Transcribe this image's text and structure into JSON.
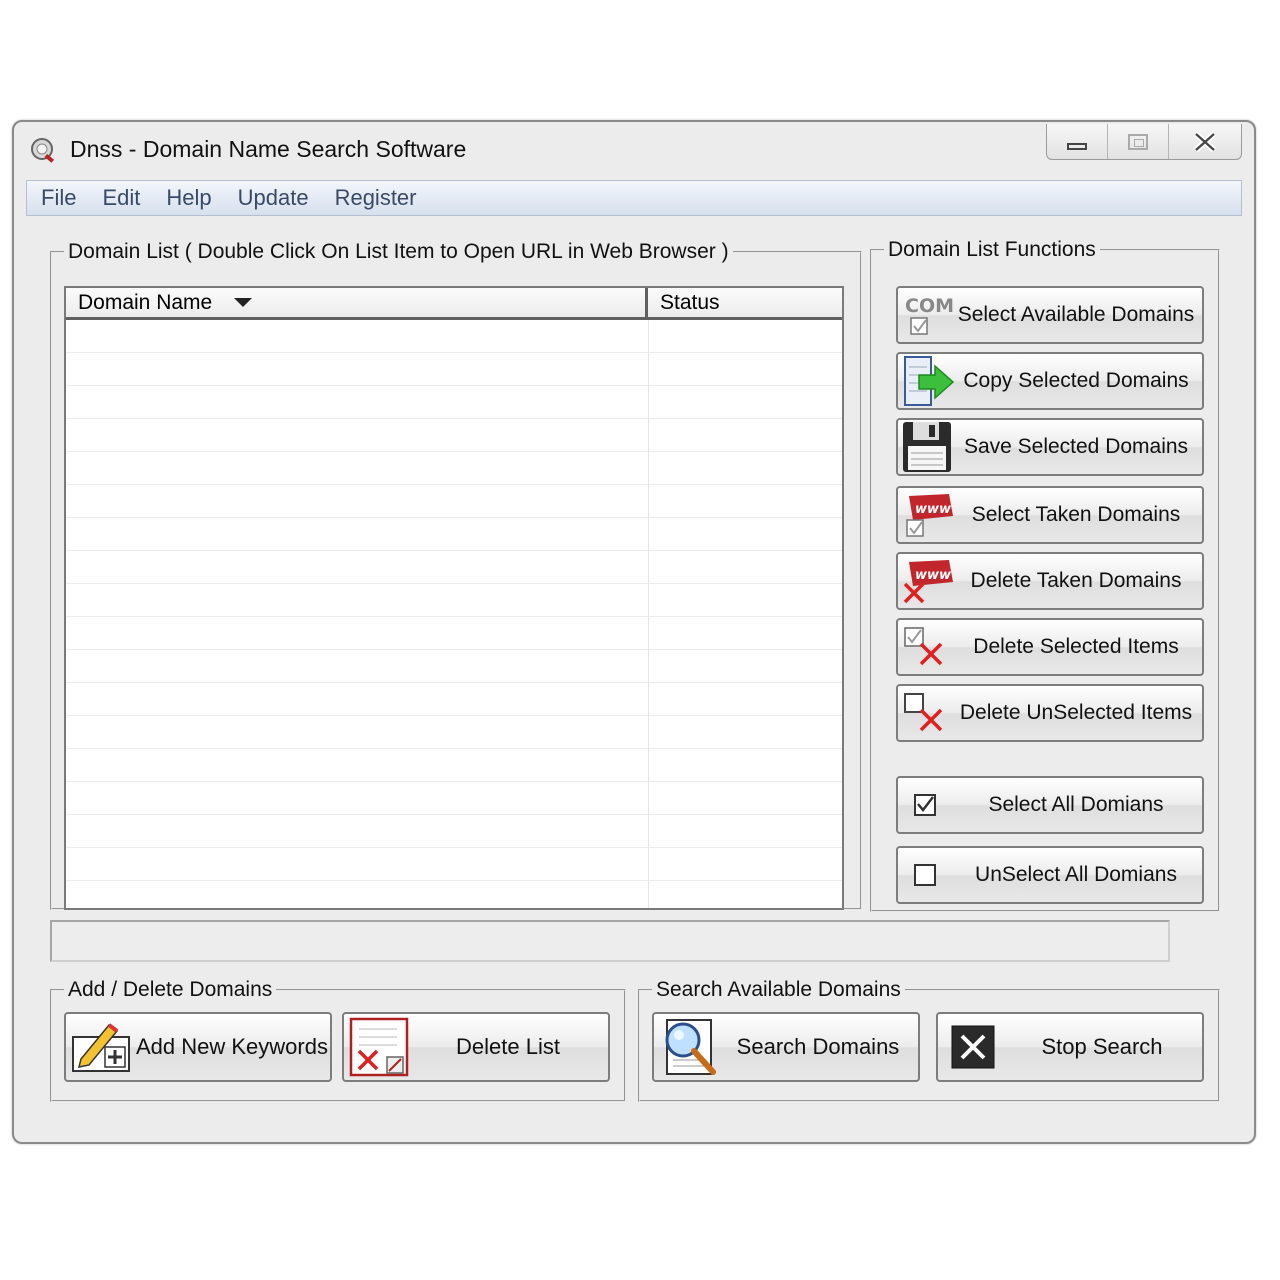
{
  "window": {
    "title": "Dnss - Domain Name Search Software"
  },
  "menu": [
    "File",
    "Edit",
    "Help",
    "Update",
    "Register"
  ],
  "domain_list": {
    "legend": "Domain List ( Double Click On List Item to Open URL in Web Browser  )",
    "columns": [
      "Domain Name",
      "Status"
    ],
    "rows": []
  },
  "functions": {
    "legend": "Domain List Functions",
    "buttons": [
      {
        "label": "Select Available Domains",
        "icon": "com-checkbox-icon"
      },
      {
        "label": "Copy Selected Domains",
        "icon": "copy-arrow-icon"
      },
      {
        "label": "Save Selected Domains",
        "icon": "floppy-disk-icon"
      },
      {
        "label": "Select Taken Domains",
        "icon": "www-checkbox-icon"
      },
      {
        "label": "Delete Taken Domains",
        "icon": "www-delete-icon"
      },
      {
        "label": "Delete Selected Items",
        "icon": "checked-delete-icon"
      },
      {
        "label": "Delete UnSelected Items",
        "icon": "unchecked-delete-icon"
      },
      {
        "label": "Select All Domians",
        "icon": "checked-box-icon"
      },
      {
        "label": "UnSelect All Domians",
        "icon": "empty-box-icon"
      }
    ]
  },
  "add_delete": {
    "legend": "Add / Delete Domains",
    "add_label": "Add New Keywords",
    "delete_label": "Delete List"
  },
  "search": {
    "legend": "Search Available Domains",
    "search_label": "Search Domains",
    "stop_label": "Stop Search"
  },
  "status_text": "",
  "colors": {
    "menubar": "#d6e0ee",
    "window_bg": "#ececec",
    "delete_red": "#e02020",
    "copy_green": "#3cbf3c"
  }
}
